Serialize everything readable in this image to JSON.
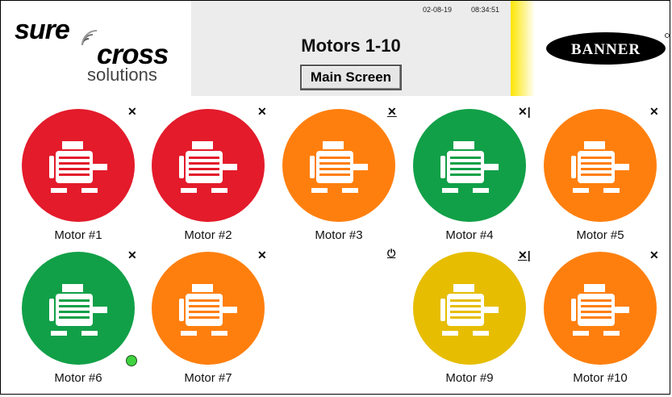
{
  "header": {
    "date": "02-08-19",
    "time": "08:34:51",
    "title": "Motors 1-10",
    "main_button_label": "Main Screen"
  },
  "logos": {
    "left": {
      "sure": "sure",
      "cross": "cross",
      "solutions": "solutions"
    },
    "right": {
      "text": "BANNER"
    }
  },
  "colors": {
    "red": "#e31b2b",
    "orange": "#ff7f0e",
    "green": "#11a048",
    "yellow": "#e6bd00",
    "header_bg": "#ececec",
    "accent_yellow": "#fbe500"
  },
  "motors": [
    {
      "label": "Motor #1",
      "color": "red",
      "corner_icon": "close-icon"
    },
    {
      "label": "Motor #2",
      "color": "red",
      "corner_icon": "close-icon"
    },
    {
      "label": "Motor #3",
      "color": "orange",
      "corner_icon": "close-underline-icon"
    },
    {
      "label": "Motor #4",
      "color": "green",
      "corner_icon": "close-bar-icon"
    },
    {
      "label": "Motor #5",
      "color": "orange",
      "corner_icon": "close-icon"
    },
    {
      "label": "Motor #6",
      "color": "green",
      "corner_icon": "close-icon",
      "status_indicator": "green"
    },
    {
      "label": "Motor #7",
      "color": "orange",
      "corner_icon": "close-icon"
    },
    {
      "label": "",
      "color": "none",
      "corner_icon": "power-icon"
    },
    {
      "label": "Motor #9",
      "color": "yellow",
      "corner_icon": "close-underline-icon"
    },
    {
      "label": "Motor #10",
      "color": "orange",
      "corner_icon": "close-icon"
    }
  ]
}
